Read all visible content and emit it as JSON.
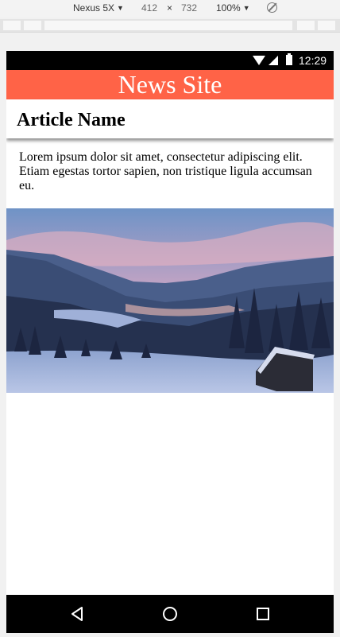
{
  "devtools": {
    "device_name": "Nexus 5X",
    "width": "412",
    "times": "×",
    "height": "732",
    "zoom": "100%"
  },
  "status_bar": {
    "time": "12:29",
    "icons": [
      "wifi-icon",
      "signal-icon",
      "battery-icon"
    ]
  },
  "header": {
    "site_title": "News Site",
    "color": "#ff6347"
  },
  "article": {
    "title": "Article Name",
    "body": "Lorem ipsum dolor sit amet, consectetur adipiscing elit. Etiam egestas tortor sapien, non tristique ligula accumsan eu.",
    "image_subject": "snowy mountain valley at dusk with small cabin"
  },
  "nav_bar": {
    "buttons": [
      "back-icon",
      "home-icon",
      "recents-icon"
    ]
  }
}
